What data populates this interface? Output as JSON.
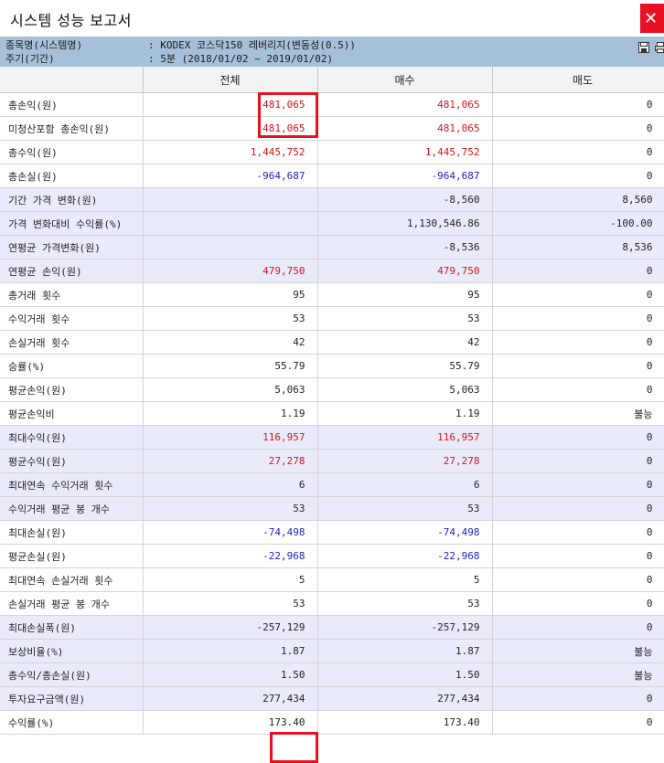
{
  "window": {
    "title": "시스템 성능 보고서",
    "close_label": "✕"
  },
  "info": {
    "item_label": "종목명(시스템명)",
    "item_value": ": KODEX 코스닥150 레버리지(변동성(0.5))",
    "period_label": "주기(기간)",
    "period_value": ": 5분 (2018/01/02 ~ 2019/01/02)",
    "icons": [
      "save-icon",
      "print-icon"
    ]
  },
  "table": {
    "headers": [
      "",
      "전체",
      "매수",
      "매도"
    ],
    "rows": [
      {
        "label": "총손익(원)",
        "total": "481,065",
        "buy": "481,065",
        "sell": "0",
        "color": "red",
        "shade": false
      },
      {
        "label": "미청산포함 총손익(원)",
        "total": "481,065",
        "buy": "481,065",
        "sell": "0",
        "color": "red",
        "shade": false
      },
      {
        "label": "총수익(원)",
        "total": "1,445,752",
        "buy": "1,445,752",
        "sell": "0",
        "color": "red",
        "shade": false
      },
      {
        "label": "총손실(원)",
        "total": "-964,687",
        "buy": "-964,687",
        "sell": "0",
        "color": "blue",
        "shade": false
      },
      {
        "label": "기간 가격 변화(원)",
        "total": "",
        "buy": "-8,560",
        "sell": "8,560",
        "color": "",
        "shade": true
      },
      {
        "label": "가격 변화대비 수익률(%)",
        "total": "",
        "buy": "1,130,546.86",
        "sell": "-100.00",
        "color": "",
        "shade": true
      },
      {
        "label": "연평균 가격변화(원)",
        "total": "",
        "buy": "-8,536",
        "sell": "8,536",
        "color": "",
        "shade": true
      },
      {
        "label": "연평균 손익(원)",
        "total": "479,750",
        "buy": "479,750",
        "sell": "0",
        "color": "red",
        "shade": true
      },
      {
        "label": "총거래 횟수",
        "total": "95",
        "buy": "95",
        "sell": "0",
        "color": "",
        "shade": false
      },
      {
        "label": "수익거래 횟수",
        "total": "53",
        "buy": "53",
        "sell": "0",
        "color": "",
        "shade": false
      },
      {
        "label": "손실거래 횟수",
        "total": "42",
        "buy": "42",
        "sell": "0",
        "color": "",
        "shade": false
      },
      {
        "label": "승률(%)",
        "total": "55.79",
        "buy": "55.79",
        "sell": "0",
        "color": "",
        "shade": false
      },
      {
        "label": "평균손익(원)",
        "total": "5,063",
        "buy": "5,063",
        "sell": "0",
        "color": "",
        "shade": false
      },
      {
        "label": "평균손익비",
        "total": "1.19",
        "buy": "1.19",
        "sell": "불능",
        "color": "",
        "shade": false
      },
      {
        "label": "최대수익(원)",
        "total": "116,957",
        "buy": "116,957",
        "sell": "0",
        "color": "red",
        "shade": true
      },
      {
        "label": "평균수익(원)",
        "total": "27,278",
        "buy": "27,278",
        "sell": "0",
        "color": "red",
        "shade": true
      },
      {
        "label": "최대연속 수익거래 횟수",
        "total": "6",
        "buy": "6",
        "sell": "0",
        "color": "",
        "shade": true
      },
      {
        "label": "수익거래 평균 봉 개수",
        "total": "53",
        "buy": "53",
        "sell": "0",
        "color": "",
        "shade": true
      },
      {
        "label": "최대손실(원)",
        "total": "-74,498",
        "buy": "-74,498",
        "sell": "0",
        "color": "blue",
        "shade": false
      },
      {
        "label": "평균손실(원)",
        "total": "-22,968",
        "buy": "-22,968",
        "sell": "0",
        "color": "blue",
        "shade": false
      },
      {
        "label": "최대연속 손실거래 횟수",
        "total": "5",
        "buy": "5",
        "sell": "0",
        "color": "",
        "shade": false
      },
      {
        "label": "손실거래 평균 봉 개수",
        "total": "53",
        "buy": "53",
        "sell": "0",
        "color": "",
        "shade": false
      },
      {
        "label": "최대손실폭(원)",
        "total": "-257,129",
        "buy": "-257,129",
        "sell": "0",
        "color": "",
        "shade": true
      },
      {
        "label": "보상비율(%)",
        "total": "1.87",
        "buy": "1.87",
        "sell": "불능",
        "color": "",
        "shade": true
      },
      {
        "label": "총수익/총손실(원)",
        "total": "1.50",
        "buy": "1.50",
        "sell": "불능",
        "color": "",
        "shade": true
      },
      {
        "label": "투자요구금액(원)",
        "total": "277,434",
        "buy": "277,434",
        "sell": "0",
        "color": "",
        "shade": true
      },
      {
        "label": "수익률(%)",
        "total": "173.40",
        "buy": "173.40",
        "sell": "0",
        "color": "",
        "shade": false
      }
    ]
  },
  "colors": {
    "header_panel": "#a7c0d9",
    "shade_row": "#e9ebfb",
    "positive": "#d4141a",
    "negative": "#1c1fc8",
    "highlight": "#e8111d",
    "close_button": "#e81123"
  }
}
